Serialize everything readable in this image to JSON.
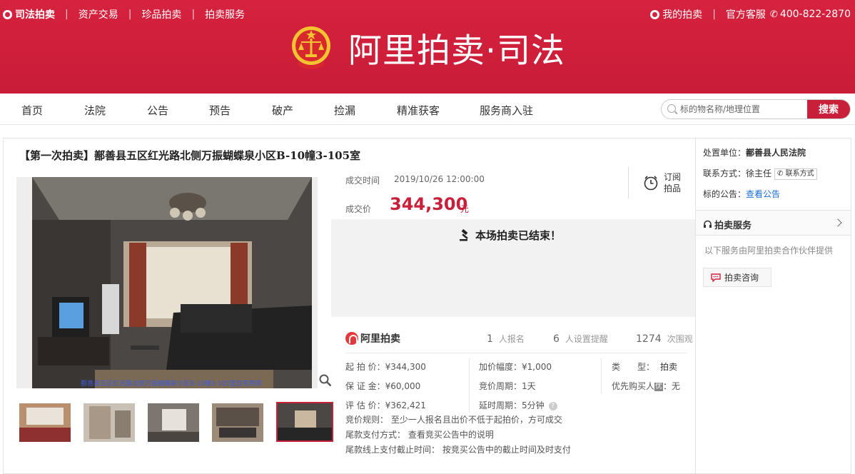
{
  "topbar": {
    "brand": "司法拍卖",
    "links": [
      "资产交易",
      "珍品拍卖",
      "拍卖服务"
    ],
    "my_auction": "我的拍卖",
    "service": "官方客服",
    "phone": "400-822-2870"
  },
  "logo": {
    "text": "阿里拍卖·司法"
  },
  "nav": {
    "items": [
      "首页",
      "法院",
      "公告",
      "预告",
      "破产",
      "捡漏",
      "精准获客",
      "服务商入驻"
    ],
    "search_placeholder": "标的物名称/地理位置",
    "search_button": "搜索"
  },
  "item": {
    "title": "【第一次拍卖】鄯善县五区红光路北侧万振蝴蝶泉小区B-10幢3-105室",
    "photo_caption": "鄯善县五区红光路北侧万振蝴蝶泉小区B-10幢3-105室住宅用房",
    "thumb_count": 5,
    "selected_thumb": 5
  },
  "deal": {
    "time_label": "成交时间",
    "time_value": "2019/10/26 12:00:00",
    "price_label": "成交价",
    "price_value": "344,300",
    "price_unit": "元",
    "subscribe_label": "订阅拍品",
    "ended_text": "本场拍卖已结束！"
  },
  "stats": {
    "brand": "阿里拍卖",
    "registrations": "1",
    "registrations_label": "人报名",
    "reminders": "6",
    "reminders_label": "人设置提醒",
    "views": "1274",
    "views_label": "次围观"
  },
  "terms": {
    "start_price_label": "起 拍 价：",
    "start_price": "¥344,300",
    "deposit_label": "保 证 金：",
    "deposit": "¥60,000",
    "appraisal_label": "评 估 价：",
    "appraisal": "¥362,421",
    "increment_label": "加价幅度：",
    "increment": "¥1,000",
    "cycle_label": "竞价周期：",
    "cycle": "1天",
    "delay_label": "延时周期：",
    "delay": "5分钟",
    "type_label": "类　　型：",
    "type": "拍卖",
    "priority_label": "优先购买人",
    "priority_badge": "优",
    "priority_value": "：无"
  },
  "rules": [
    "竞价规则：  至少一人报名且出价不低于起拍价，方可成交",
    "尾款支付方式：  查看竞买公告中的说明",
    "尾款线上支付截止时间：  按竞买公告中的截止时间及时支付"
  ],
  "side": {
    "court_label": "处置单位：",
    "court": "鄯善县人民法院",
    "contact_label": "联系方式：",
    "contact": "徐主任",
    "contact_button": "联系方式",
    "notice_label": "标的公告：",
    "notice_link": "查看公告",
    "service_title": "拍卖服务",
    "service_note": "以下服务由阿里拍卖合作伙伴提供",
    "consult": "拍卖咨询"
  },
  "colors": {
    "brand_red": "#c8203a",
    "header_red": "#d6223e",
    "link_blue": "#1a6dd8"
  }
}
